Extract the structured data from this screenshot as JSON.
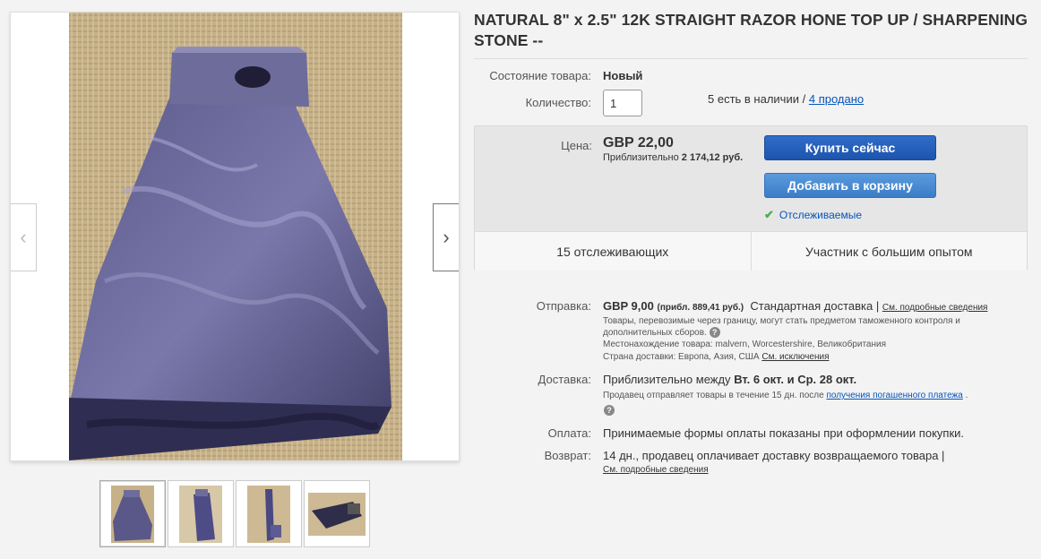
{
  "title": "NATURAL 8\" x 2.5\" 12K STRAIGHT RAZOR HONE TOP UP / SHARPENING STONE --",
  "condition": {
    "label": "Состояние товара:",
    "value": "Новый"
  },
  "quantity": {
    "label": "Количество:",
    "value": "1",
    "available": "5 есть в наличии",
    "separator": "/",
    "sold": "4 продано"
  },
  "buybox": {
    "price_label": "Цена:",
    "price": "GBP 22,00",
    "approx_prefix": "Приблизительно",
    "approx_value": "2 174,12 руб.",
    "buy_now": "Купить сейчас",
    "add_to_cart": "Добавить в корзину",
    "watching": "Отслеживаемые",
    "watchers": "15 отслеживающих",
    "seller": "Участник с большим опытом"
  },
  "shipping": {
    "label": "Отправка:",
    "price": "GBP 9,00",
    "approx": "(прибл. 889,41 руб.)",
    "service": "Стандартная доставка",
    "sep": "|",
    "details_link": "См. подробные сведения",
    "customs_note": "Товары, перевозимые через границу, могут стать предметом таможенного контроля и дополнительных сборов.",
    "location_label": "Местонахождение товара:",
    "location": "malvern, Worcestershire, Великобритания",
    "countries_label": "Страна доставки:",
    "countries": "Европа, Азия, США",
    "exclusions_link": "См. исключения"
  },
  "delivery": {
    "label": "Доставка:",
    "prefix": "Приблизительно между",
    "range": "Вт. 6 окт. и Ср. 28 окт.",
    "note": "Продавец отправляет товары в течение 15 дн. после",
    "note_link": "получения погашенного платежа",
    "note_end": "."
  },
  "payments": {
    "label": "Оплата:",
    "value": "Принимаемые формы оплаты показаны при оформлении покупки."
  },
  "returns": {
    "label": "Возврат:",
    "value": "14 дн., продавец оплачивает доставку возвращаемого товара |",
    "link": "См. подробные сведения"
  },
  "icons": {
    "prev": "chevron-left-icon",
    "next": "chevron-right-icon",
    "check": "checkmark-icon",
    "help": "question-icon"
  },
  "colors": {
    "buy_button": "#1d54ad",
    "cart_button": "#3b7cc7",
    "link": "#0654ba",
    "stone": "#4a4a78",
    "burlap": "#c9b48c"
  }
}
